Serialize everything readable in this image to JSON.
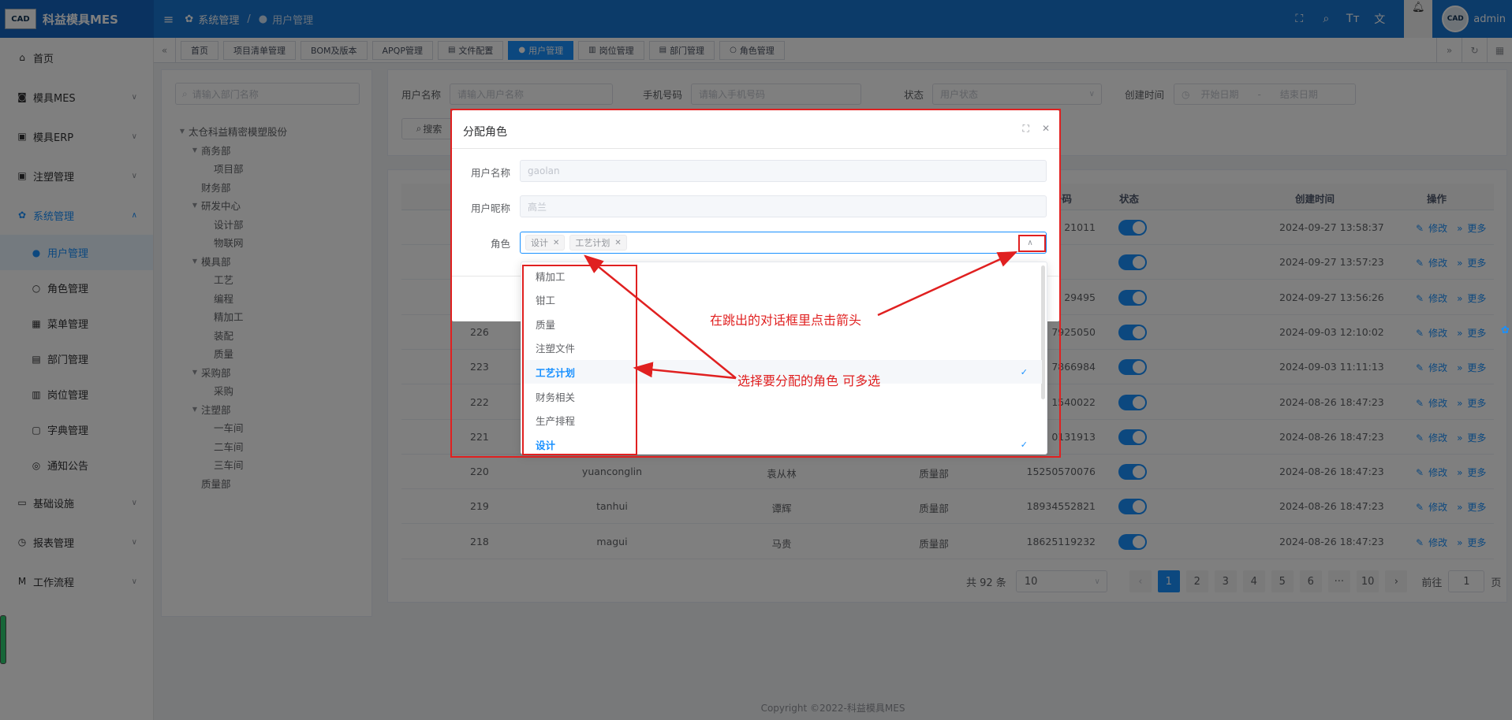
{
  "app": {
    "logo_text": "CAD",
    "title": "科益模具MES"
  },
  "sidebar": {
    "items": [
      {
        "label": "首页",
        "icon": "home-icon"
      },
      {
        "label": "模具MES",
        "icon": "camera-icon"
      },
      {
        "label": "模具ERP",
        "icon": "briefcase-icon"
      },
      {
        "label": "注塑管理",
        "icon": "briefcase-icon"
      },
      {
        "label": "系统管理",
        "icon": "gear-icon"
      },
      {
        "label": "基础设施",
        "icon": "monitor-icon"
      },
      {
        "label": "报表管理",
        "icon": "chart-icon"
      },
      {
        "label": "工作流程",
        "icon": "flow-icon"
      }
    ],
    "system_children": [
      {
        "label": "用户管理",
        "icon": "user-icon"
      },
      {
        "label": "角色管理",
        "icon": "user-outline-icon"
      },
      {
        "label": "菜单管理",
        "icon": "grid-icon"
      },
      {
        "label": "部门管理",
        "icon": "id-card-icon"
      },
      {
        "label": "岗位管理",
        "icon": "post-icon"
      },
      {
        "label": "字典管理",
        "icon": "dict-icon"
      },
      {
        "label": "通知公告",
        "icon": "message-icon"
      }
    ]
  },
  "navbar": {
    "breadcrumb_parent": "系统管理",
    "breadcrumb_current": "用户管理",
    "username": "admin",
    "avatar_text": "CAD"
  },
  "tags": [
    "首页",
    "项目清单管理",
    "BOM及版本",
    "APQP管理",
    "文件配置",
    "用户管理",
    "岗位管理",
    "部门管理",
    "角色管理"
  ],
  "dept_tree": {
    "search_placeholder": "请输入部门名称",
    "nodes": [
      {
        "label": "太仓科益精密模塑股份",
        "level": 0,
        "expandable": true
      },
      {
        "label": "商务部",
        "level": 1,
        "expandable": true
      },
      {
        "label": "项目部",
        "level": 2,
        "expandable": false
      },
      {
        "label": "财务部",
        "level": 1,
        "expandable": false
      },
      {
        "label": "研发中心",
        "level": 1,
        "expandable": true
      },
      {
        "label": "设计部",
        "level": 2,
        "expandable": false
      },
      {
        "label": "物联网",
        "level": 2,
        "expandable": false
      },
      {
        "label": "模具部",
        "level": 1,
        "expandable": true
      },
      {
        "label": "工艺",
        "level": 2,
        "expandable": false
      },
      {
        "label": "编程",
        "level": 2,
        "expandable": false
      },
      {
        "label": "精加工",
        "level": 2,
        "expandable": false
      },
      {
        "label": "装配",
        "level": 2,
        "expandable": false
      },
      {
        "label": "质量",
        "level": 2,
        "expandable": false
      },
      {
        "label": "采购部",
        "level": 1,
        "expandable": true
      },
      {
        "label": "采购",
        "level": 2,
        "expandable": false
      },
      {
        "label": "注塑部",
        "level": 1,
        "expandable": true
      },
      {
        "label": "一车间",
        "level": 2,
        "expandable": false
      },
      {
        "label": "二车间",
        "level": 2,
        "expandable": false
      },
      {
        "label": "三车间",
        "level": 2,
        "expandable": false
      },
      {
        "label": "质量部",
        "level": 1,
        "expandable": false
      }
    ]
  },
  "query": {
    "username_label": "用户名称",
    "username_placeholder": "请输入用户名称",
    "phone_label": "手机号码",
    "phone_placeholder": "请输入手机号码",
    "status_label": "状态",
    "status_placeholder": "用户状态",
    "created_label": "创建时间",
    "start_placeholder": "开始日期",
    "date_sep": "-",
    "end_placeholder": "结束日期",
    "search_button": "搜索"
  },
  "table": {
    "headers": {
      "phone": "号码",
      "status": "状态",
      "created": "创建时间",
      "ops": "操作"
    },
    "edit_label": "修改",
    "more_label": "更多",
    "rows": [
      {
        "id": "",
        "username": "",
        "nickname": "",
        "dept": "",
        "phone": "21011",
        "created": "2024-09-27 13:58:37"
      },
      {
        "id": "",
        "username": "",
        "nickname": "",
        "dept": "",
        "phone": "",
        "created": "2024-09-27 13:57:23"
      },
      {
        "id": "",
        "username": "",
        "nickname": "",
        "dept": "",
        "phone": "29495",
        "created": "2024-09-27 13:56:26"
      },
      {
        "id": "226",
        "username": "",
        "nickname": "",
        "dept": "",
        "phone": "7925050",
        "created": "2024-09-03 12:10:02"
      },
      {
        "id": "223",
        "username": "",
        "nickname": "",
        "dept": "",
        "phone": "7866984",
        "created": "2024-09-03 11:11:13"
      },
      {
        "id": "222",
        "username": "",
        "nickname": "",
        "dept": "",
        "phone": "1540022",
        "created": "2024-08-26 18:47:23"
      },
      {
        "id": "221",
        "username": "",
        "nickname": "",
        "dept": "",
        "phone": "0131913",
        "created": "2024-08-26 18:47:23"
      },
      {
        "id": "220",
        "username": "yuanconglin",
        "nickname": "袁从林",
        "dept": "质量部",
        "phone": "15250570076",
        "created": "2024-08-26 18:47:23"
      },
      {
        "id": "219",
        "username": "tanhui",
        "nickname": "谭辉",
        "dept": "质量部",
        "phone": "18934552821",
        "created": "2024-08-26 18:47:23"
      },
      {
        "id": "218",
        "username": "magui",
        "nickname": "马贵",
        "dept": "质量部",
        "phone": "18625119232",
        "created": "2024-08-26 18:47:23"
      }
    ]
  },
  "pagination": {
    "total_text": "共 92 条",
    "page_size": "10",
    "pages": [
      "1",
      "2",
      "3",
      "4",
      "5",
      "6",
      "···",
      "10"
    ],
    "current": "1",
    "goto_label": "前往",
    "goto_value": "1",
    "page_suffix": "页"
  },
  "copyright": "Copyright ©2022-科益模具MES",
  "dialog": {
    "title": "分配角色",
    "username_label": "用户名称",
    "username_value": "gaolan",
    "nickname_label": "用户昵称",
    "nickname_value": "高兰",
    "role_label": "角色",
    "selected_chips": [
      "设计",
      "工艺计划"
    ],
    "options": [
      {
        "label": "精加工",
        "selected": false
      },
      {
        "label": "钳工",
        "selected": false
      },
      {
        "label": "质量",
        "selected": false
      },
      {
        "label": "注塑文件",
        "selected": false
      },
      {
        "label": "工艺计划",
        "selected": true
      },
      {
        "label": "财务相关",
        "selected": false
      },
      {
        "label": "生产排程",
        "selected": false
      },
      {
        "label": "设计",
        "selected": true
      }
    ]
  },
  "annotations": {
    "click_arrow": "在跳出的对话框里点击箭头",
    "select_roles": "选择要分配的角色 可多选"
  },
  "colors": {
    "primary": "#1890ff",
    "navbar": "#1976d2",
    "annotation": "#e02020"
  }
}
